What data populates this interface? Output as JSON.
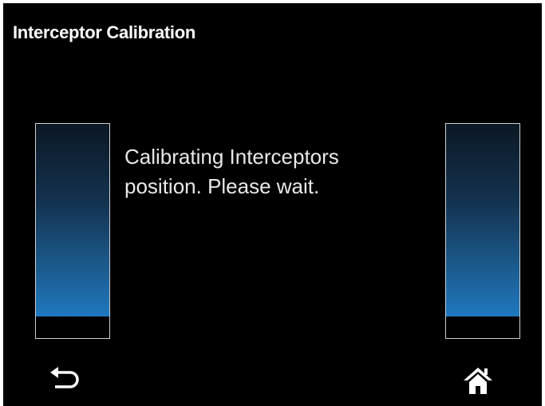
{
  "header": {
    "title": "Interceptor Calibration"
  },
  "message": {
    "line1": "Calibrating Interceptors",
    "line2": "position. Please wait."
  },
  "gauges": {
    "left_level": 0.9,
    "right_level": 0.9
  },
  "footer": {
    "back_icon": "back-arrow-icon",
    "home_icon": "home-icon"
  },
  "colors": {
    "background": "#000000",
    "gauge_fill": "#1f78bf",
    "text": "#ffffff"
  }
}
